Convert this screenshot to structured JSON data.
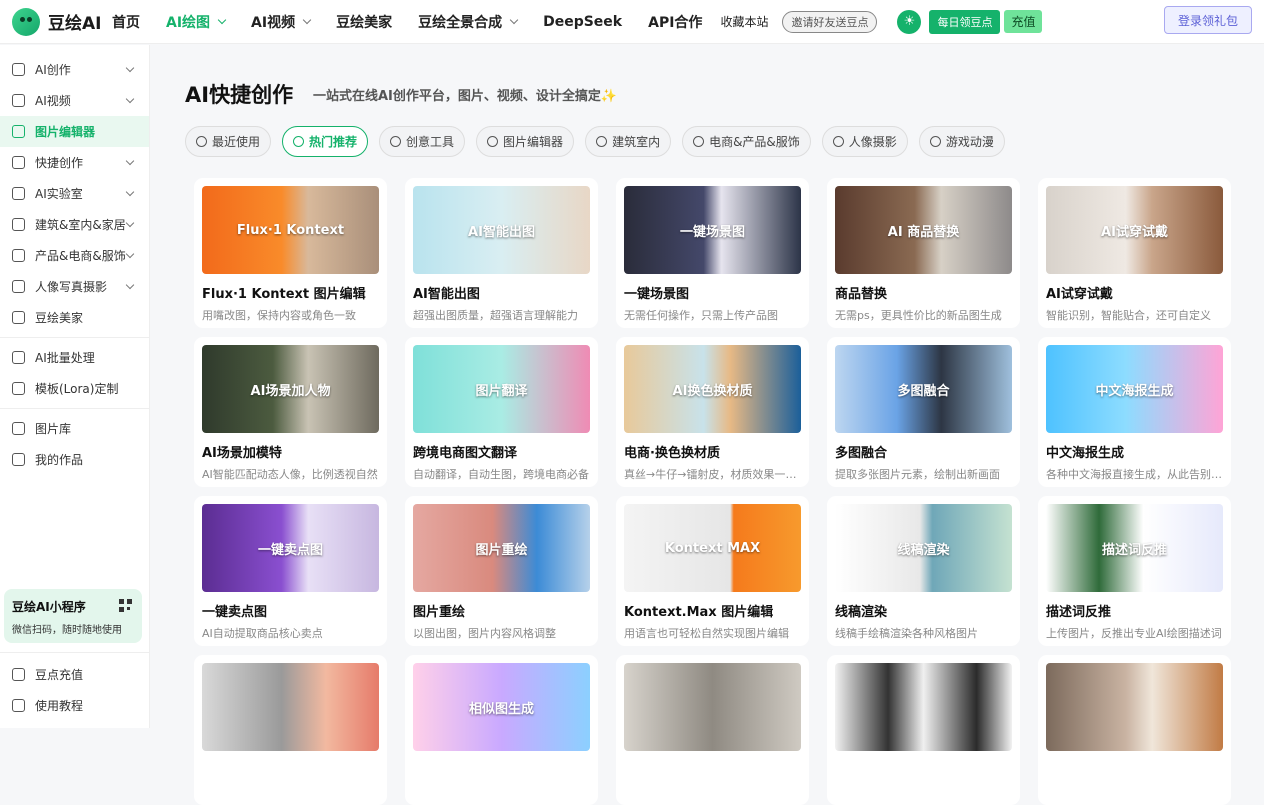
{
  "header": {
    "logo_text": "豆绘AI",
    "nav": [
      {
        "label": "首页",
        "dropdown": false,
        "active": false
      },
      {
        "label": "AI绘图",
        "dropdown": true,
        "active": true
      },
      {
        "label": "AI视频",
        "dropdown": true,
        "active": false
      },
      {
        "label": "豆绘美家",
        "dropdown": false,
        "active": false
      },
      {
        "label": "豆绘全景合成",
        "dropdown": true,
        "active": false
      },
      {
        "label": "DeepSeek",
        "dropdown": false,
        "active": false
      },
      {
        "label": "API合作",
        "dropdown": false,
        "active": false
      }
    ],
    "favorite": "收藏本站",
    "invite": "邀请好友送豆点",
    "daily": "每日领豆点",
    "recharge": "充值",
    "login": "登录领礼包",
    "accent": "#15b26b"
  },
  "sidebar": {
    "items": [
      {
        "label": "AI创作",
        "icon": "image-edit-icon",
        "chevron": true
      },
      {
        "label": "AI视频",
        "icon": "video-icon",
        "chevron": true
      },
      {
        "label": "图片编辑器",
        "icon": "image-editor-icon",
        "chevron": false,
        "active": true
      },
      {
        "label": "快捷创作",
        "icon": "cube-icon",
        "chevron": true
      },
      {
        "label": "AI实验室",
        "icon": "flask-icon",
        "chevron": true
      },
      {
        "label": "建筑&室内&家居",
        "icon": "building-icon",
        "chevron": true
      },
      {
        "label": "产品&电商&服饰",
        "icon": "shop-icon",
        "chevron": true
      },
      {
        "label": "人像写真摄影",
        "icon": "camera-icon",
        "chevron": true
      },
      {
        "label": "豆绘美家",
        "icon": "sofa-icon",
        "chevron": false
      }
    ],
    "items2": [
      {
        "label": "AI批量处理",
        "icon": "batch-icon"
      },
      {
        "label": "模板(Lora)定制",
        "icon": "template-icon"
      }
    ],
    "items3": [
      {
        "label": "图片库",
        "icon": "gallery-icon"
      },
      {
        "label": "我的作品",
        "icon": "works-icon"
      }
    ],
    "mini_program": {
      "title": "豆绘AI小程序",
      "subtitle": "微信扫码，随时随地使用"
    },
    "bottom": [
      {
        "label": "豆点充值",
        "icon": "diamond-icon"
      },
      {
        "label": "使用教程",
        "icon": "tutorial-icon"
      }
    ]
  },
  "main": {
    "title": "AI快捷创作",
    "subtitle": "一站式在线AI创作平台，图片、视频、设计全搞定✨",
    "tabs": [
      {
        "label": "最近使用",
        "icon": "clock-icon",
        "active": false
      },
      {
        "label": "热门推荐",
        "icon": "thumbs-up-icon",
        "active": true
      },
      {
        "label": "创意工具",
        "icon": "cube-icon",
        "active": false
      },
      {
        "label": "图片编辑器",
        "icon": "image-edit-icon",
        "active": false
      },
      {
        "label": "建筑室内",
        "icon": "building-icon",
        "active": false
      },
      {
        "label": "电商&产品&服饰",
        "icon": "shop-icon",
        "active": false
      },
      {
        "label": "人像摄影",
        "icon": "camera-icon",
        "active": false
      },
      {
        "label": "游戏动漫",
        "icon": "box-icon",
        "active": false
      }
    ],
    "cards": [
      {
        "title": "Flux·1 Kontext 图片编辑",
        "desc": "用嘴改图，保持内容或角色一致",
        "thumb_text": "Flux·1 Kontext",
        "bg": "linear-gradient(90deg,#f26a1b 0%,#f98b2a 45%,#d8b99b 60%,#a98f7a 100%)"
      },
      {
        "title": "AI智能出图",
        "desc": "超强出图质量，超强语言理解能力",
        "thumb_text": "AI智能出图",
        "bg": "linear-gradient(90deg,#b9e3ee 0%,#d9eef2 50%,#e8d7c6 100%)"
      },
      {
        "title": "一键场景图",
        "desc": "无需任何操作，只需上传产品图",
        "thumb_text": "一键场景图",
        "bg": "linear-gradient(90deg,#2a2c3a 0%,#44486a 45%,#e6e4ee 55%,#2c3448 100%)"
      },
      {
        "title": "商品替换",
        "desc": "无需ps，更具性价比的新品图生成",
        "thumb_text": "AI 商品替换",
        "bg": "linear-gradient(90deg,#5a3b2e 0%,#8a6a52 45%,#d7d0c6 60%,#8d8a8a 100%)"
      },
      {
        "title": "AI试穿试戴",
        "desc": "智能识别，智能贴合，还可自定义",
        "thumb_text": "AI试穿试戴",
        "bg": "linear-gradient(90deg,#d8d2cb 0%,#efe9e3 45%,#c9a58a 60%,#8a5a3c 100%)"
      },
      {
        "title": "AI场景加模特",
        "desc": "AI智能匹配动态人像，比例透视自然",
        "thumb_text": "AI场景加人物",
        "bg": "linear-gradient(90deg,#2f3a2c 0%,#4c5b3f 40%,#c9c3b4 60%,#6e6a5e 100%)"
      },
      {
        "title": "跨境电商图文翻译",
        "desc": "自动翻译，自动生图，跨境电商必备",
        "thumb_text": "图片翻译",
        "bg": "linear-gradient(90deg,#7fe0d9 0%,#a9ece4 50%,#ef8bb4 100%)"
      },
      {
        "title": "电商·换色换材质",
        "desc": "真丝→牛仔→镭射皮，材质效果一键替换",
        "thumb_text": "AI换色换材质",
        "bg": "linear-gradient(90deg,#e8c99a 0%,#c8e2ea 45%,#e7b985 60%,#1b5f9a 100%)"
      },
      {
        "title": "多图融合",
        "desc": "提取多张图片元素，绘制出新画面",
        "thumb_text": "多图融合",
        "bg": "linear-gradient(90deg,#bdd6f0 0%,#6aa3e6 35%,#2d3644 60%,#9fc0dd 100%)"
      },
      {
        "title": "中文海报生成",
        "desc": "各种中文海报直接生成，从此告别设计",
        "thumb_text": "中文海报生成",
        "bg": "linear-gradient(90deg,#4ec2ff 0%,#8ddcff 45%,#ffa4d6 100%)"
      },
      {
        "title": "一键卖点图",
        "desc": "AI自动提取商品核心卖点",
        "thumb_text": "一键卖点图",
        "bg": "linear-gradient(90deg,#5b2d92 0%,#8a4fd0 45%,#e8e0f6 60%,#c7b7e0 100%)"
      },
      {
        "title": "图片重绘",
        "desc": "以图出图，图片内容风格调整",
        "thumb_text": "图片重绘",
        "bg": "linear-gradient(90deg,#e5a8a1 0%,#d98a7e 45%,#3c8bd6 70%,#b6d1ea 100%)"
      },
      {
        "title": "Kontext.Max 图片编辑",
        "desc": "用语言也可轻松自然实现图片编辑",
        "thumb_text": "Kontext MAX",
        "bg": "linear-gradient(90deg,#f4f4f4 0%,#e6e6e6 60%,#f57a1c 62%,#f79a2d 100%)"
      },
      {
        "title": "线稿渲染",
        "desc": "线稿手绘稿渲染各种风格图片",
        "thumb_text": "线稿渲染",
        "bg": "linear-gradient(90deg,#ffffff 0%,#e8e8e8 48%,#6fa7b8 55%,#c5e2d1 100%)"
      },
      {
        "title": "描述词反推",
        "desc": "上传图片，反推出专业AI绘图描述词",
        "thumb_text": "描述词反推",
        "bg": "linear-gradient(90deg,#ffffff 0%,#2f6b3a 30%,#ffffff 55%,#e6e9fb 100%)"
      },
      {
        "title": "",
        "desc": "",
        "thumb_text": "",
        "bg": "linear-gradient(90deg,#d9d9d9 0%,#9a9a9a 45%,#f2b9a0 70%,#e67b6a 100%)"
      },
      {
        "title": "",
        "desc": "",
        "thumb_text": "相似图生成",
        "bg": "linear-gradient(90deg,#ffd0e9 0%,#c9a9ff 50%,#8cd0ff 100%)"
      },
      {
        "title": "",
        "desc": "",
        "thumb_text": "",
        "bg": "linear-gradient(90deg,#d7d3cc 0%,#8f8a82 50%,#cfcac2 100%)"
      },
      {
        "title": "",
        "desc": "",
        "thumb_text": "",
        "bg": "linear-gradient(90deg,#f2f2f2 0%,#333 30%,#f0f0f0 50%,#2b2b2b 80%,#f2f2f2 100%)"
      },
      {
        "title": "",
        "desc": "",
        "thumb_text": "",
        "bg": "linear-gradient(90deg,#7c6a5c 0%,#c9b3a2 45%,#f0e6da 60%,#c17b45 100%)"
      }
    ]
  }
}
